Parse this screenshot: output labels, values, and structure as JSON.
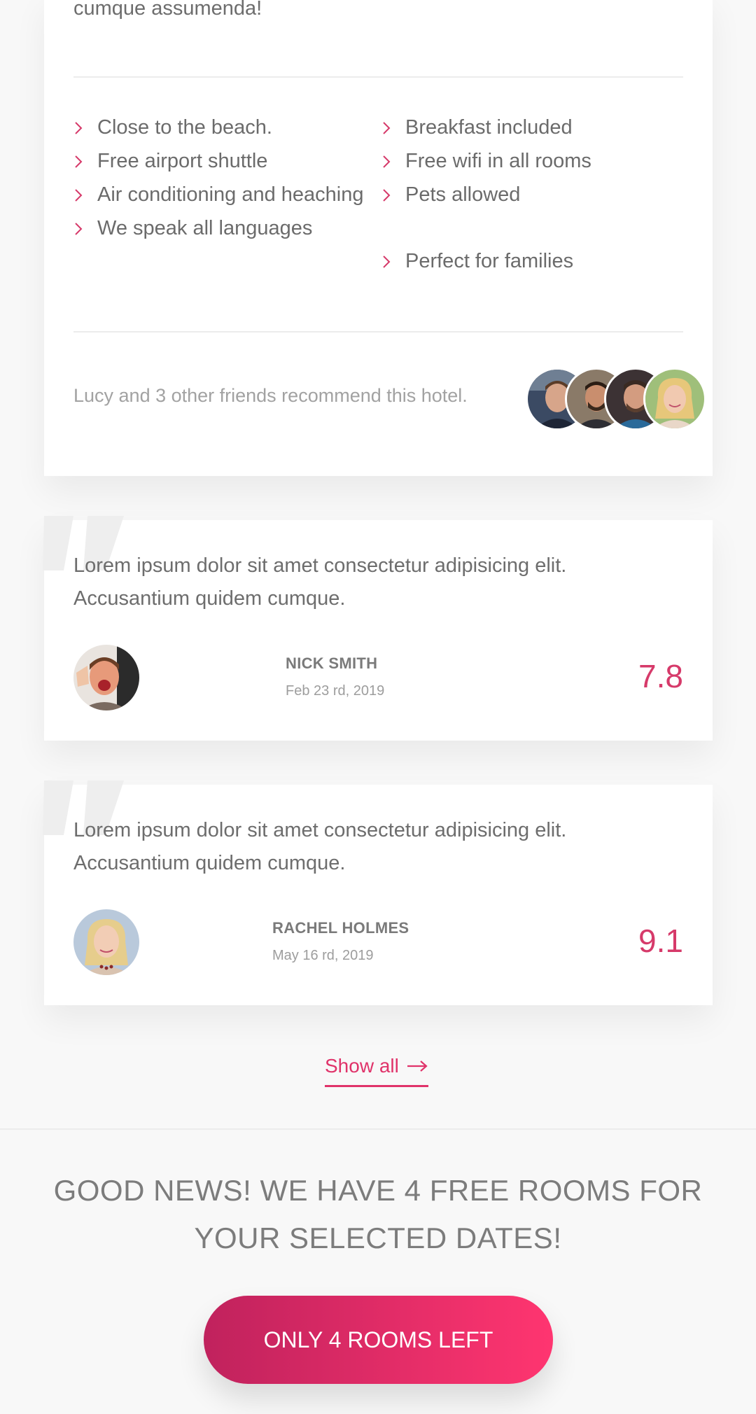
{
  "hotel": {
    "intro_text": "cumque assumenda!",
    "features_left": [
      "Close to the beach.",
      "Free airport shuttle",
      "Air conditioning and heaching",
      "We speak all languages"
    ],
    "features_right": [
      "Breakfast included",
      "Free wifi in all rooms",
      "Pets allowed",
      "Perfect for families"
    ],
    "friends_text": "Lucy and 3 other friends recommend this hotel."
  },
  "reviews": [
    {
      "text": "Lorem ipsum dolor sit amet consectetur adipisicing elit. Accusantium quidem cumque.",
      "name": "NICK SMITH",
      "date": "Feb 23 rd, 2019",
      "score": "7.8"
    },
    {
      "text": "Lorem ipsum dolor sit amet consectetur adipisicing elit. Accusantium quidem cumque.",
      "name": "RACHEL HOLMES",
      "date": "May 16 rd, 2019",
      "score": "9.1"
    }
  ],
  "show_all_label": "Show all",
  "good_news": "GOOD NEWS! WE HAVE 4 FREE ROOMS FOR YOUR SELECTED DATES!",
  "cta_label": "ONLY 4 ROOMS LEFT",
  "colors": {
    "accent": "#e0336a",
    "gradient_start": "#c0225d",
    "gradient_end": "#ff3570"
  }
}
